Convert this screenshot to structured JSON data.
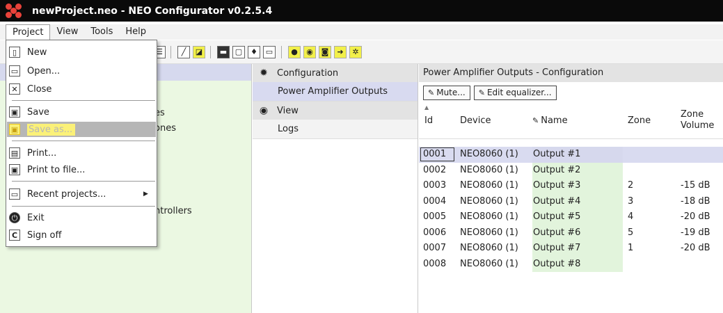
{
  "window": {
    "title": "newProject.neo - NEO Configurator v0.2.5.4"
  },
  "menubar": [
    "Project",
    "View",
    "Tools",
    "Help"
  ],
  "project_menu": {
    "new": "New",
    "open": "Open...",
    "close": "Close",
    "save": "Save",
    "save_as": "Save as...",
    "print": "Print...",
    "print_to_file": "Print to file...",
    "recent": "Recent projects...",
    "exit": "Exit",
    "sign_off": "Sign off"
  },
  "left_panel_partial": [
    "es",
    "ones",
    "ntrollers"
  ],
  "nav": {
    "configuration": "Configuration",
    "power_amplifier_outputs": "Power Amplifier Outputs",
    "view": "View",
    "logs": "Logs"
  },
  "content": {
    "header": "Power Amplifier Outputs - Configuration",
    "mute_button": "Mute...",
    "edit_equalizer_button": "Edit equalizer...",
    "columns": {
      "id": "Id",
      "device": "Device",
      "name": "Name",
      "zone": "Zone",
      "zone_volume_1": "Zone",
      "zone_volume_2": "Volume"
    },
    "rows": [
      {
        "id": "0001",
        "device": "NEO8060 (1)",
        "name": "Output #1",
        "zone": "",
        "volume": ""
      },
      {
        "id": "0002",
        "device": "NEO8060 (1)",
        "name": "Output #2",
        "zone": "",
        "volume": ""
      },
      {
        "id": "0003",
        "device": "NEO8060 (1)",
        "name": "Output #3",
        "zone": "2",
        "volume": "-15 dB"
      },
      {
        "id": "0004",
        "device": "NEO8060 (1)",
        "name": "Output #4",
        "zone": "3",
        "volume": "-18 dB"
      },
      {
        "id": "0005",
        "device": "NEO8060 (1)",
        "name": "Output #5",
        "zone": "4",
        "volume": "-20 dB"
      },
      {
        "id": "0006",
        "device": "NEO8060 (1)",
        "name": "Output #6",
        "zone": "5",
        "volume": "-19 dB"
      },
      {
        "id": "0007",
        "device": "NEO8060 (1)",
        "name": "Output #7",
        "zone": "1",
        "volume": "-20 dB"
      },
      {
        "id": "0008",
        "device": "NEO8060 (1)",
        "name": "Output #8",
        "zone": "",
        "volume": ""
      }
    ]
  },
  "colors": {
    "title_bg": "#0a0a0a",
    "left_panel_bg": "#ebf8e2",
    "selection": "#d8daf0",
    "menu_highlight": "#fbf178"
  }
}
